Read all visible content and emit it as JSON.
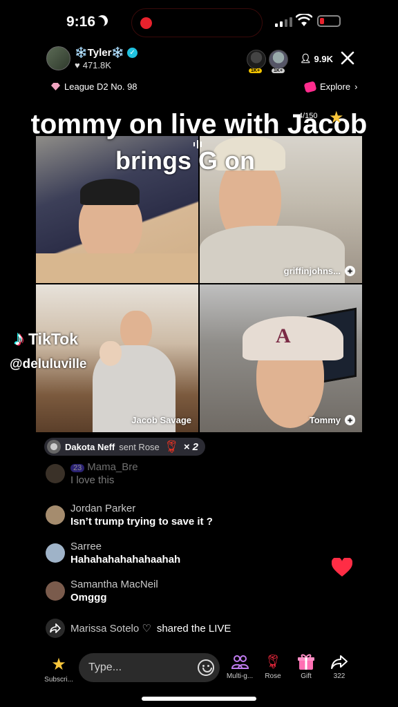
{
  "status_bar": {
    "time": "9:16"
  },
  "host": {
    "name": "❄️Tyler❄️",
    "likes": "471.8K",
    "viewer_count": "9.9K",
    "viewer_badges": [
      "1K+",
      "1K+"
    ],
    "league": "League D2 No. 98",
    "explore_label": "Explore"
  },
  "overlay": {
    "caption_line1": "tommy on live with Jacob",
    "caption_line2": "brings G on",
    "counter": "4/150"
  },
  "participants": [
    {
      "label": ""
    },
    {
      "label": "griffinjohns..."
    },
    {
      "label": "Jacob Savage"
    },
    {
      "label": "Tommy"
    }
  ],
  "watermark": {
    "brand": "TikTok",
    "handle": "@deluluville"
  },
  "gift": {
    "sender": "Dakota Neff",
    "verb": "sent Rose",
    "count": "× 2"
  },
  "comments": [
    {
      "user": "Mama_Bre",
      "badge": "23",
      "text": "I love this",
      "avatar_color": "#6b5a4a"
    },
    {
      "user": "Jordan Parker",
      "text": "Isn’t trump trying to save it ?",
      "avatar_color": "#a58c6e"
    },
    {
      "user": "Sarree",
      "text": "Hahahahahahahaahah",
      "avatar_color": "#9fb3c8"
    },
    {
      "user": "Samantha MacNeil",
      "text": "Omggg",
      "avatar_color": "#7a5b4c"
    }
  ],
  "share": {
    "name": "Marissa Sotelo ♡",
    "action": "shared the LIVE"
  },
  "bottom_bar": {
    "subscribe_label": "Subscri...",
    "input_placeholder": "Type...",
    "multi_label": "Multi-g...",
    "rose_label": "Rose",
    "gift_label": "Gift",
    "share_count": "322"
  },
  "colors": {
    "accent_red": "#e8222d",
    "heart": "#ff2d45",
    "gold": "#f8c63b"
  }
}
